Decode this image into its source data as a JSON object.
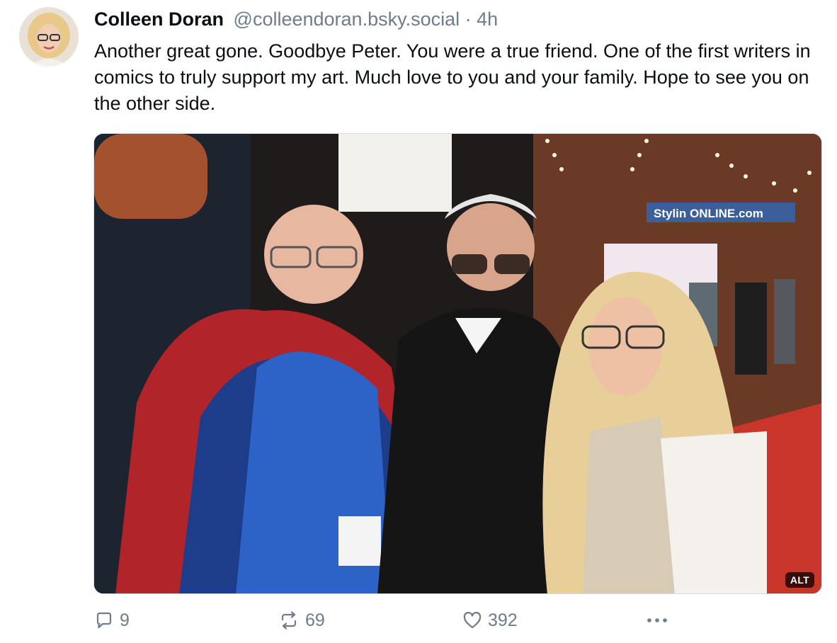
{
  "post": {
    "author": {
      "display_name": "Colleen Doran",
      "handle": "@colleendoran.bsky.social"
    },
    "separator": "·",
    "timestamp": "4h",
    "text": "Another great gone. Goodbye Peter. You were a true friend. One of the first writers in comics to truly support my art. Much love to you and your family. Hope to see you on the other side.",
    "media": {
      "alt_badge": "ALT",
      "banner_text": "Stylin ONLINE.com"
    },
    "actions": {
      "reply_count": "9",
      "repost_count": "69",
      "like_count": "392"
    }
  },
  "icons": {
    "reply": "speech-bubble-icon",
    "repost": "repost-arrows-icon",
    "like": "heart-icon",
    "more": "ellipsis-icon"
  },
  "colors": {
    "text_primary": "#0b0f14",
    "text_secondary": "#6f7c8b",
    "border": "#d6dde4"
  }
}
